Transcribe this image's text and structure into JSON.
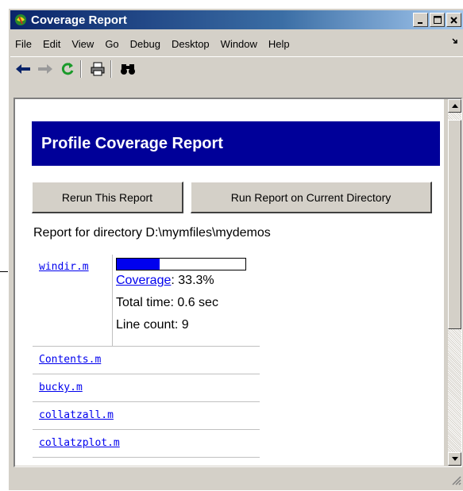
{
  "window": {
    "title": "Coverage Report"
  },
  "menu": [
    "File",
    "Edit",
    "View",
    "Go",
    "Debug",
    "Desktop",
    "Window",
    "Help"
  ],
  "report": {
    "banner": "Profile Coverage Report",
    "buttons": {
      "rerun": "Rerun This Report",
      "run_current": "Run Report on Current Directory"
    },
    "directory_line": "Report for directory D:\\mymfiles\\mydemos",
    "files": [
      {
        "name": "windir.m",
        "coverage_fraction": 0.333,
        "coverage_link": "Coverage",
        "coverage_value": ": 33.3%",
        "total_time": "Total time: 0.6 sec",
        "line_count": "Line count: 9"
      },
      {
        "name": "Contents.m"
      },
      {
        "name": "bucky.m"
      },
      {
        "name": "collatzall.m"
      },
      {
        "name": "collatzplot.m"
      }
    ]
  },
  "colors": {
    "banner_bg": "#000099",
    "link": "#0000ee",
    "titlebar": "#0a246a"
  }
}
